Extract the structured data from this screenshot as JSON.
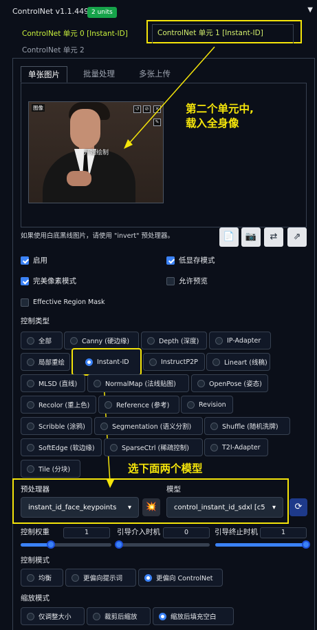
{
  "header": {
    "title": "ControlNet v1.1.449",
    "units_badge": "2 units",
    "collapse_icon": "triangle-down-icon"
  },
  "unit_tabs": [
    {
      "label": "ControlNet 单元 0 [Instant-ID]"
    },
    {
      "label": "ControlNet 单元 1 [Instant-ID]"
    },
    {
      "label": "ControlNet 单元 2"
    }
  ],
  "image_tabs": [
    "单张图片",
    "批量处理",
    "多张上传"
  ],
  "image_panel": {
    "badge": "图像",
    "overlay_text": "开始绘制"
  },
  "hint_text": "如果使用白底黑线图片，请使用 \"invert\" 预处理器。",
  "toolbar_icons": [
    "document-icon",
    "camera-icon",
    "swap-icon",
    "arrow-up-icon"
  ],
  "checkboxes": [
    {
      "label": "启用",
      "checked": true
    },
    {
      "label": "低显存模式",
      "checked": true
    },
    {
      "label": "完美像素模式",
      "checked": true
    },
    {
      "label": "允许预览",
      "checked": false
    },
    {
      "label": "Effective Region Mask",
      "checked": false
    }
  ],
  "control_type": {
    "label": "控制类型",
    "options": [
      "全部",
      "Canny (硬边缘)",
      "Depth (深度)",
      "IP-Adapter",
      "局部重绘",
      "Instant-ID",
      "InstructP2P",
      "Lineart (线稿)",
      "MLSD (直线)",
      "NormalMap (法线贴图)",
      "OpenPose (姿态)",
      "Recolor (重上色)",
      "Reference (参考)",
      "Revision",
      "Scribble (涂鸦)",
      "Segmentation (语义分割)",
      "Shuffle (随机洗牌)",
      "SoftEdge (软边缘)",
      "SparseCtrl (稀疏控制)",
      "T2I-Adapter",
      "Tile (分块)"
    ],
    "selected": "Instant-ID"
  },
  "preprocessor": {
    "label": "预处理器",
    "value": "instant_id_face_keypoints"
  },
  "model": {
    "label": "模型",
    "value": "control_instant_id_sdxl [c5"
  },
  "sliders": [
    {
      "label": "控制权重",
      "value": "1",
      "fraction": 0.33
    },
    {
      "label": "引导介入时机",
      "value": "0",
      "fraction": 0.0
    },
    {
      "label": "引导终止时机",
      "value": "1",
      "fraction": 1.0
    }
  ],
  "control_mode": {
    "label": "控制模式",
    "options": [
      "均衡",
      "更偏向提示词",
      "更偏向 ControlNet"
    ],
    "selected": "更偏向 ControlNet"
  },
  "resize_mode": {
    "label": "缩放模式",
    "options": [
      "仅调整大小",
      "裁剪后缩放",
      "缩放后填充空白"
    ],
    "selected": "缩放后填充空白"
  },
  "annotations": {
    "note1_line1": "第二个单元中,",
    "note1_line2": "载入全身像",
    "note2": "选下面两个模型"
  },
  "colors": {
    "accent": "#3b82f6",
    "annotation": "#f5e50a",
    "badge": "#16a34a",
    "unit_tab_active": "#c8f03c"
  }
}
